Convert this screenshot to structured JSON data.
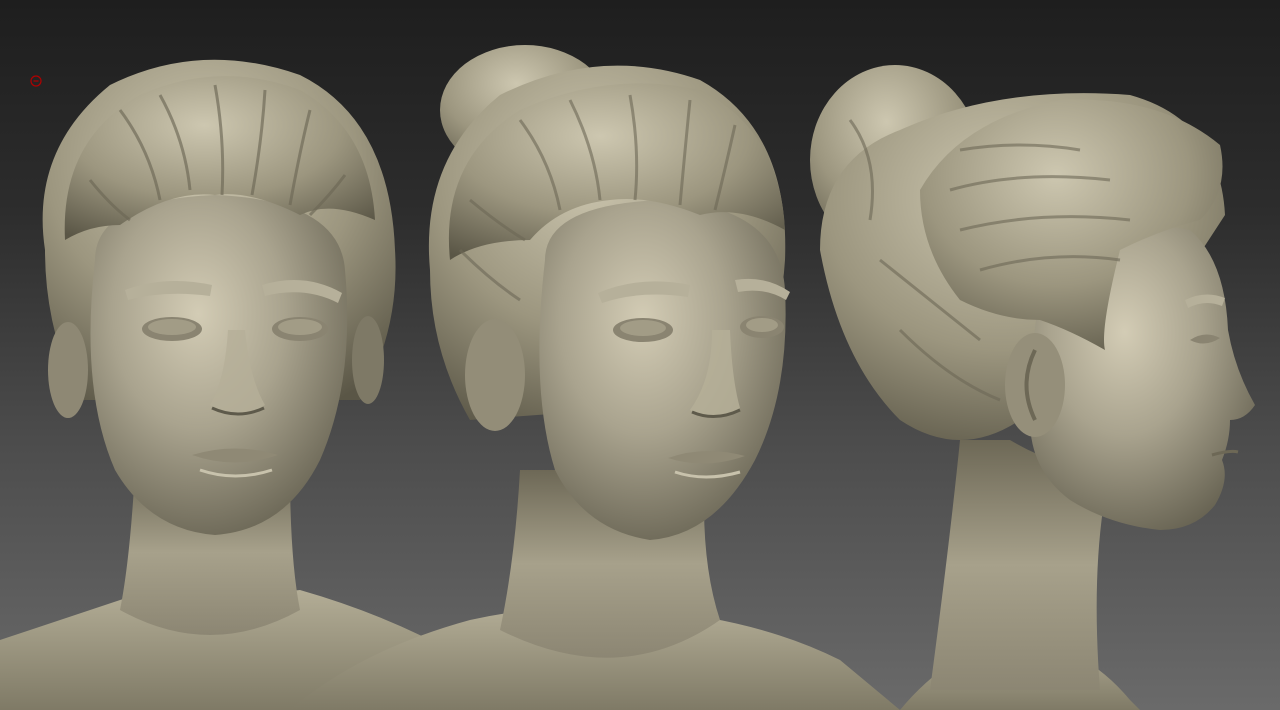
{
  "scene": {
    "background_top": "#1e1e1e",
    "background_bottom": "#6a6a6a",
    "clay_color": "#a49f8c",
    "clay_light": "#cfc9b3",
    "clay_dark": "#5e5a4b",
    "marker_color": "#b00000"
  },
  "views": [
    {
      "name": "front-view"
    },
    {
      "name": "three-quarter-view"
    },
    {
      "name": "profile-view"
    }
  ],
  "icons": {
    "marker": "target-marker-icon"
  }
}
